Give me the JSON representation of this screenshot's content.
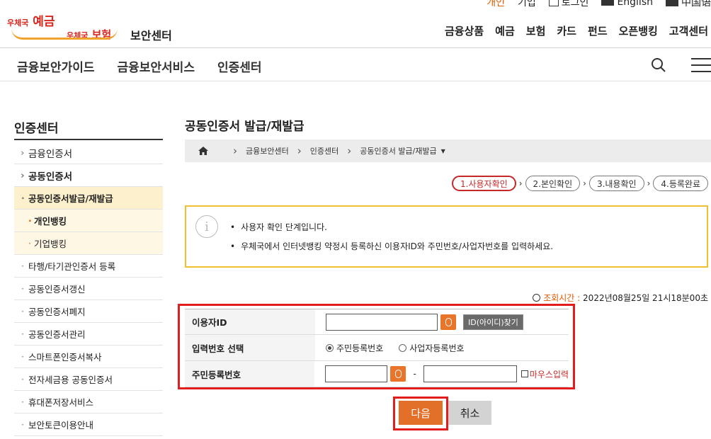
{
  "util": {
    "personal": "개인",
    "business": "기업",
    "login": "로그인",
    "english": "English",
    "chinese": "中国语"
  },
  "logo": {
    "deposit_prefix": "우체국",
    "deposit": "예금",
    "insurance_prefix": "우체국",
    "insurance": "보험",
    "site_title": "보안센터"
  },
  "gnb": [
    "금융상품",
    "예금",
    "보험",
    "카드",
    "펀드",
    "오픈뱅킹",
    "고객센터"
  ],
  "subnav": [
    "금융보안가이드",
    "금융보안서비스",
    "인증센터"
  ],
  "sidebar": {
    "title": "인증센터",
    "items": [
      {
        "label": "금융인증서"
      },
      {
        "label": "공동인증서"
      },
      {
        "label": "공동인증서발급/재발급"
      },
      {
        "label": "개인뱅킹"
      },
      {
        "label": "기업뱅킹"
      },
      {
        "label": "타행/타기관인증서 등록"
      },
      {
        "label": "공동인증서갱신"
      },
      {
        "label": "공동인증서폐지"
      },
      {
        "label": "공동인증서관리"
      },
      {
        "label": "스마트폰인증서복사"
      },
      {
        "label": "전자세금용 공동인증서"
      },
      {
        "label": "휴대폰저장서비스"
      },
      {
        "label": "보안토큰이용안내"
      }
    ]
  },
  "page": {
    "title": "공동인증서 발급/재발급",
    "breadcrumb": [
      "금융보안센터",
      "인증센터",
      "공동인증서 발급/재발급"
    ]
  },
  "steps": [
    "1.사용자확인",
    "2.본인확인",
    "3.내용확인",
    "4.등록완료"
  ],
  "notice": {
    "line1": "사용자 확인 단계입니다.",
    "line2": "우체국에서 인터넷뱅킹 약정시 등록하신 이용자ID와 주민번호/사업자번호를 입력하세요."
  },
  "lookup": {
    "label": "조회시간 :",
    "value": "2022년08월25일 21시18분00초"
  },
  "form": {
    "user_id_label": "이용자ID",
    "user_id_value": "",
    "find_id_label": "ID(아이디)찾기",
    "type_label": "입력번호 선택",
    "type_options": [
      "주민등록번호",
      "사업자등록번호"
    ],
    "type_selected": "주민등록번호",
    "rrn_label": "주민등록번호",
    "rrn_first": "",
    "rrn_dash": "-",
    "rrn_second": "",
    "mouse_input_label": "마우스입력"
  },
  "buttons": {
    "next": "다음",
    "cancel": "취소"
  },
  "colors": {
    "accent": "#e27028",
    "highlight_red": "#e11d1d",
    "notice_border": "#f0c030"
  }
}
